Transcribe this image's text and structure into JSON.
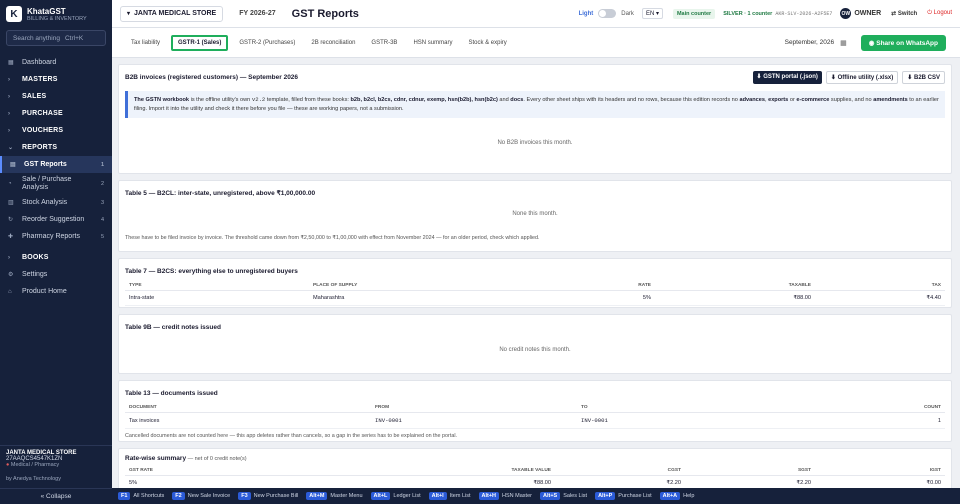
{
  "app": {
    "name": "KhataGST",
    "subtitle": "BILLING & INVENTORY",
    "logo": "K"
  },
  "sidebar": {
    "search_placeholder": "Search anything",
    "search_shortcut": "Ctrl+K",
    "items": [
      {
        "label": "Dashboard",
        "icon": "dashboard-icon",
        "count": ""
      },
      {
        "label": "MASTERS",
        "icon": "chevron-right-icon",
        "count": ""
      },
      {
        "label": "SALES",
        "icon": "chevron-right-icon",
        "count": ""
      },
      {
        "label": "PURCHASE",
        "icon": "chevron-right-icon",
        "count": ""
      },
      {
        "label": "VOUCHERS",
        "icon": "chevron-right-icon",
        "count": ""
      },
      {
        "label": "REPORTS",
        "icon": "chevron-down-icon",
        "count": ""
      },
      {
        "label": "GST Reports",
        "icon": "report-icon",
        "count": "1"
      },
      {
        "label": "Sale / Purchase Analysis",
        "icon": "analysis-icon",
        "count": "2"
      },
      {
        "label": "Stock Analysis",
        "icon": "stock-icon",
        "count": "3"
      },
      {
        "label": "Reorder Suggestion",
        "icon": "reorder-icon",
        "count": "4"
      },
      {
        "label": "Pharmacy Reports",
        "icon": "pharmacy-icon",
        "count": "5"
      },
      {
        "label": "BOOKS",
        "icon": "chevron-right-icon",
        "count": ""
      },
      {
        "label": "Settings",
        "icon": "gear-icon",
        "count": ""
      },
      {
        "label": "Product Home",
        "icon": "home-icon",
        "count": ""
      }
    ],
    "shop_name": "JANTA MEDICAL STORE",
    "gstin": "27AAQCS4547K1ZN",
    "category": "Medical / Pharmacy",
    "by": "by Anedya Technology",
    "collapse": "« Collapse"
  },
  "topbar": {
    "shop": "JANTA MEDICAL STORE",
    "fy": "FY 2026-27",
    "title": "GST Reports",
    "light": "Light",
    "dark": "Dark",
    "lang": "EN",
    "counter": "Main counter",
    "plan": "SILVER · 1 counter",
    "plan_code": "AKR-SLV-2026-A2F5E7",
    "owner_initials": "OW",
    "owner": "OWNER",
    "switch": "Switch",
    "logout": "Logout"
  },
  "tabs": [
    {
      "label": "Tax liability",
      "active": false
    },
    {
      "label": "GSTR-1 (Sales)",
      "active": true
    },
    {
      "label": "GSTR-2 (Purchases)",
      "active": false
    },
    {
      "label": "2B reconciliation",
      "active": false
    },
    {
      "label": "GSTR-3B",
      "active": false
    },
    {
      "label": "HSN summary",
      "active": false
    },
    {
      "label": "Stock & expiry",
      "active": false
    }
  ],
  "month": "September, 2026",
  "whatsapp": "Share on WhatsApp",
  "b2b": {
    "title": "B2B invoices (registered customers) — September 2026",
    "btn_portal": "GSTN portal (.json)",
    "btn_offline": "Offline utility (.xlsx)",
    "btn_csv": "B2B CSV",
    "info_1": "The GSTN workbook",
    "info_2": " is the offline utility's own ",
    "info_ver": "v2.2",
    "info_3": " template, filled from these books: ",
    "books": "b2b, b2cl, b2cs, cdnr, cdnur, exemp, hsn(b2b), hsn(b2c)",
    "info_4": " and ",
    "docs": "docs",
    "info_5": ". Every other sheet ships with its headers and no rows, because this edition records no ",
    "adv": "advances",
    "sep1": ", ",
    "exp": "exports",
    "sep2": " or ",
    "ecom": "e-commerce",
    "info_6": " supplies, and no ",
    "amend": "amendments",
    "info_7": " to an earlier filing. Import it into the utility and check it there before you file — these are working papers, not a submission.",
    "empty": "No B2B invoices this month."
  },
  "b2cl": {
    "title": "Table 5 — B2CL: inter-state, unregistered, above ₹1,00,000.00",
    "empty": "None this month.",
    "note": "These have to be filed invoice by invoice. The threshold came down from ₹2,50,000 to ₹1,00,000 with effect from November 2024 — for an older period, check which applied."
  },
  "b2cs": {
    "title": "Table 7 — B2CS: everything else to unregistered buyers",
    "headers": [
      "TYPE",
      "PLACE OF SUPPLY",
      "RATE",
      "TAXABLE",
      "TAX"
    ],
    "rows": [
      [
        "Intra-state",
        "Maharashtra",
        "5%",
        "₹88.00",
        "₹4.40"
      ]
    ]
  },
  "cdn": {
    "title": "Table 9B — credit notes issued",
    "empty": "No credit notes this month."
  },
  "docs": {
    "title": "Table 13 — documents issued",
    "headers": [
      "DOCUMENT",
      "FROM",
      "TO",
      "COUNT"
    ],
    "rows": [
      [
        "Tax invoices",
        "INV-0001",
        "INV-0001",
        "1"
      ]
    ],
    "note": "Cancelled documents are not counted here — this app deletes rather than cancels, so a gap in the series has to be explained on the portal."
  },
  "rate": {
    "title": "Rate-wise summary",
    "sub": " — net of 0 credit note(s)",
    "headers": [
      "GST RATE",
      "TAXABLE VALUE",
      "CGST",
      "SGST",
      "IGST"
    ],
    "rows": [
      [
        "5%",
        "₹88.00",
        "₹2.20",
        "₹2.20",
        "₹0.00"
      ]
    ]
  },
  "footer": [
    {
      "key": "F1",
      "label": "All Shortcuts"
    },
    {
      "key": "F2",
      "label": "New Sale Invoice"
    },
    {
      "key": "F3",
      "label": "New Purchase Bill"
    },
    {
      "key": "Alt+M",
      "label": "Master Menu"
    },
    {
      "key": "Alt+L",
      "label": "Ledger List"
    },
    {
      "key": "Alt+I",
      "label": "Item List"
    },
    {
      "key": "Alt+H",
      "label": "HSN Master"
    },
    {
      "key": "Alt+S",
      "label": "Sales List"
    },
    {
      "key": "Alt+P",
      "label": "Purchase List"
    },
    {
      "key": "Alt+A",
      "label": "Help"
    }
  ]
}
